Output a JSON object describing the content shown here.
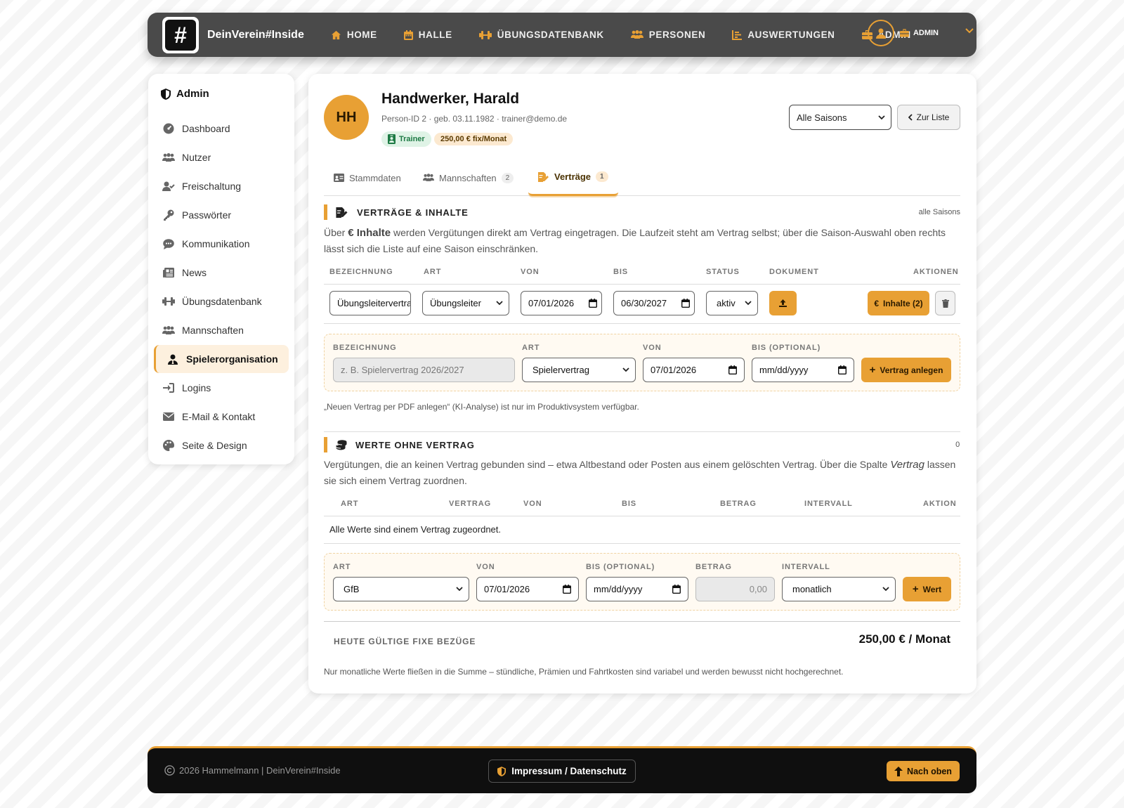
{
  "nav": {
    "brand": "DeinVerein#Inside",
    "logo_glyph": "#",
    "items": [
      {
        "label": "HOME",
        "icon": "home-icon"
      },
      {
        "label": "HALLE",
        "icon": "calendar-icon"
      },
      {
        "label": "ÜBUNGSDATENBANK",
        "icon": "dumbbell-icon"
      },
      {
        "label": "PERSONEN",
        "icon": "people-icon"
      },
      {
        "label": "AUSWERTUNGEN",
        "icon": "chart-icon"
      },
      {
        "label": "ADMIN",
        "icon": "toolbox-icon"
      }
    ],
    "user_role": "ADMIN",
    "accent": "#e8a034"
  },
  "sidebar": {
    "title": "Admin",
    "items": [
      {
        "label": "Dashboard",
        "icon": "gauge-icon"
      },
      {
        "label": "Nutzer",
        "icon": "users-icon"
      },
      {
        "label": "Freischaltung",
        "icon": "user-check-icon"
      },
      {
        "label": "Passwörter",
        "icon": "key-icon"
      },
      {
        "label": "Kommunikation",
        "icon": "chat-icon"
      },
      {
        "label": "News",
        "icon": "newspaper-icon"
      },
      {
        "label": "Übungsdatenbank",
        "icon": "dumbbell-icon"
      },
      {
        "label": "Mannschaften",
        "icon": "people-icon"
      },
      {
        "label": "Spielerorganisation",
        "icon": "user-tie-icon",
        "active": true
      },
      {
        "label": "Logins",
        "icon": "sign-in-icon"
      },
      {
        "label": "E-Mail & Kontakt",
        "icon": "envelope-icon"
      },
      {
        "label": "Seite & Design",
        "icon": "palette-icon"
      }
    ]
  },
  "person": {
    "initials": "HH",
    "name": "Handwerker, Harald",
    "meta": "Person-ID 2 · geb. 03.11.1982 · trainer@demo.de",
    "badge_role": "Trainer",
    "badge_fix": "250,00 € fix/Monat",
    "season_select": "Alle Saisons",
    "back_button": "Zur Liste"
  },
  "tabs": [
    {
      "label": "Stammdaten",
      "count": ""
    },
    {
      "label": "Mannschaften",
      "count": "2"
    },
    {
      "label": "Verträge",
      "count": "1",
      "active": true
    }
  ],
  "contracts": {
    "title": "VERTRÄGE & INHALTE",
    "scope": "alle Saisons",
    "intro_pre": "Über",
    "intro_em": "€ Inhalte",
    "intro_post": "werden Vergütungen direkt am Vertrag eingetragen. Die Laufzeit steht am Vertrag selbst; über die Saison-Auswahl oben rechts lässt sich die Liste auf eine Saison einschränken.",
    "headers": [
      "BEZEICHNUNG",
      "ART",
      "VON",
      "BIS",
      "STATUS",
      "DOKUMENT",
      "AKTIONEN"
    ],
    "row": {
      "bezeichnung": "Übungsleitervertrag",
      "art": "Übungsleiter",
      "von": "07/01/2026",
      "bis": "06/30/2027",
      "status": "aktiv",
      "inhalte_button": "Inhalte (2)"
    },
    "new": {
      "labels": [
        "BEZEICHNUNG",
        "ART",
        "VON",
        "BIS (OPTIONAL)"
      ],
      "placeholder": "z. B. Spielervertrag 2026/2027",
      "art": "Spielervertrag",
      "von": "07/01/2026",
      "bis": "mm/dd/yyyy",
      "button": "Vertrag anlegen"
    },
    "pdf_note": "„Neuen Vertrag per PDF anlegen“ (KI-Analyse) ist nur im Produktivsystem verfügbar."
  },
  "values": {
    "title": "WERTE OHNE VERTRAG",
    "count": "0",
    "intro_pre": "Vergütungen, die an keinen Vertrag gebunden sind – etwa Altbestand oder Posten aus einem gelöschten Vertrag. Über die Spalte",
    "intro_em": "Vertrag",
    "intro_post": "lassen sie sich einem Vertrag zuordnen.",
    "headers": [
      "ART",
      "VERTRAG",
      "VON",
      "BIS",
      "BETRAG",
      "INTERVALL",
      "AKTION"
    ],
    "empty": "Alle Werte sind einem Vertrag zugeordnet.",
    "new": {
      "labels": [
        "ART",
        "VON",
        "BIS (OPTIONAL)",
        "BETRAG",
        "INTERVALL"
      ],
      "art": "GfB",
      "von": "07/01/2026",
      "bis": "mm/dd/yyyy",
      "betrag": "0,00",
      "intervall": "monatlich",
      "button": "Wert"
    }
  },
  "summary": {
    "label": "HEUTE GÜLTIGE FIXE BEZÜGE",
    "value": "250,00 € / Monat",
    "note": "Nur monatliche Werte fließen in die Summe – stündliche, Prämien und Fahrtkosten sind variabel und werden bewusst nicht hochgerechnet."
  },
  "footer": {
    "copyright": "2026 Hammelmann | DeinVerein#Inside",
    "imprint": "Impressum / Datenschutz",
    "top_button": "Nach oben"
  }
}
